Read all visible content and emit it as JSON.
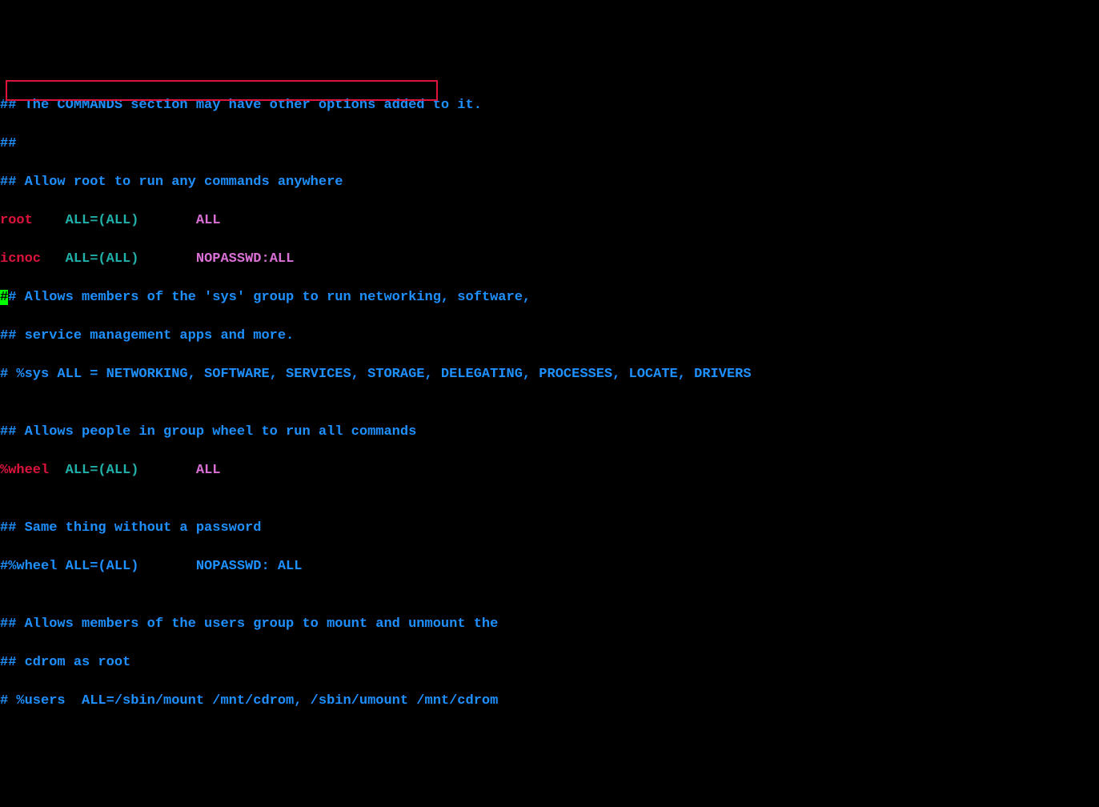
{
  "lines": {
    "l1": "## The COMMANDS section may have other options added to it.",
    "l2": "##",
    "l3": "## Allow root to run any commands anywhere",
    "l4_user": "root",
    "l4_pad": "    ",
    "l4_spec": "ALL=(ALL)",
    "l4_pad2": "       ",
    "l4_cmd": "ALL",
    "l5_user": "icnoc",
    "l5_pad": "   ",
    "l5_spec": "ALL=(ALL)",
    "l5_pad2": "       ",
    "l5_cmd": "NOPASSWD:ALL",
    "l6_hash": "#",
    "l6_rest": "# Allows members of the 'sys' group to run networking, software,",
    "l7": "## service management apps and more.",
    "l8": "# %sys ALL = NETWORKING, SOFTWARE, SERVICES, STORAGE, DELEGATING, PROCESSES, LOCATE, DRIVERS",
    "l9": "",
    "l10": "## Allows people in group wheel to run all commands",
    "l11_user": "%wheel",
    "l11_pad": "  ",
    "l11_spec": "ALL=(ALL)",
    "l11_pad2": "       ",
    "l11_cmd": "ALL",
    "l12": "",
    "l13": "## Same thing without a password",
    "l14": "#%wheel ALL=(ALL)       NOPASSWD: ALL",
    "l15": "",
    "l16": "## Allows members of the users group to mount and unmount the",
    "l17": "## cdrom as root",
    "l18": "# %users  ALL=/sbin/mount /mnt/cdrom, /sbin/umount /mnt/cdrom"
  }
}
